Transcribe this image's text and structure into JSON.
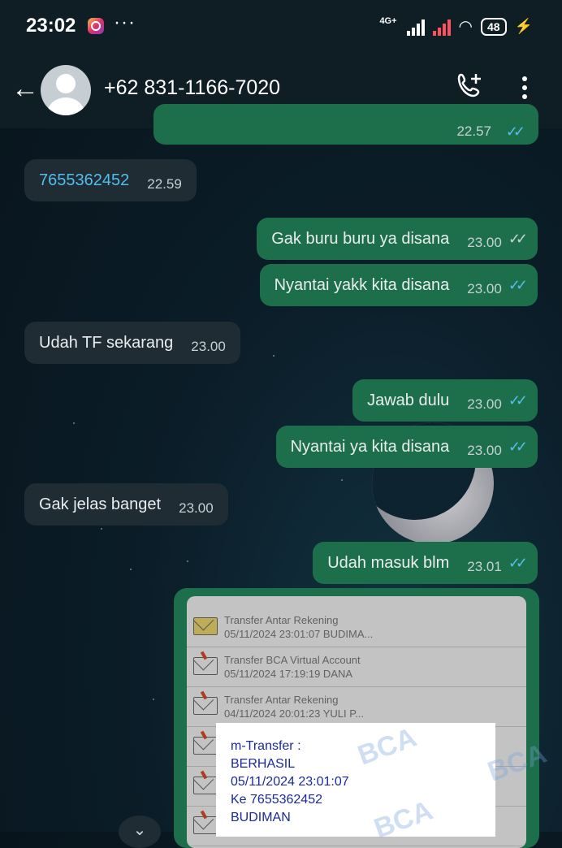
{
  "status_bar": {
    "time": "23:02",
    "more": "···",
    "network": "4G+",
    "battery": "48"
  },
  "header": {
    "contact": "+62 831-1166-7020"
  },
  "messages": [
    {
      "dir": "out",
      "text": "",
      "time": "22.57",
      "ticks": "read"
    },
    {
      "dir": "in",
      "text": "7655362452",
      "time": "22.59",
      "link": true
    },
    {
      "dir": "out",
      "text": "Gak buru buru ya disana",
      "time": "23.00",
      "ticks": "sent"
    },
    {
      "dir": "out",
      "text": "Nyantai yakk kita disana",
      "time": "23.00",
      "ticks": "read"
    },
    {
      "dir": "in",
      "text": "Udah TF sekarang",
      "time": "23.00"
    },
    {
      "dir": "out",
      "text": "Jawab dulu",
      "time": "23.00",
      "ticks": "read"
    },
    {
      "dir": "out",
      "text": "Nyantai ya kita disana",
      "time": "23.00",
      "ticks": "read"
    },
    {
      "dir": "in",
      "text": "Gak jelas banget",
      "time": "23.00"
    },
    {
      "dir": "out",
      "text": "Udah masuk blm",
      "time": "23.01",
      "ticks": "read"
    }
  ],
  "attachment": {
    "rows": [
      {
        "title": "Transfer Antar Rekening",
        "detail": "05/11/2024 23:01:07 BUDIMA...",
        "icon": "envelope-open-icon"
      },
      {
        "title": "Transfer BCA Virtual Account",
        "detail": "05/11/2024 17:19:19 DANA",
        "icon": "envelope-icon"
      },
      {
        "title": "Transfer Antar Rekening",
        "detail": "04/11/2024 20:01:23 YULI P...",
        "icon": "envelope-icon"
      },
      {
        "title": "",
        "detail": "",
        "icon": "envelope-icon"
      },
      {
        "title": "",
        "detail": "",
        "icon": "envelope-icon"
      },
      {
        "title": "",
        "detail": "",
        "icon": "envelope-icon"
      }
    ],
    "receipt": {
      "line1": "m-Transfer :",
      "line2": "BERHASIL",
      "line3": "05/11/2024 23:01:07",
      "line4": "Ke 7655362452",
      "line5": "BUDIMAN"
    },
    "watermark": "BCA"
  },
  "colors": {
    "out_bubble": "#1d6f4c",
    "in_bubble": "#1f2c34",
    "read_tick": "#53bdeb"
  }
}
